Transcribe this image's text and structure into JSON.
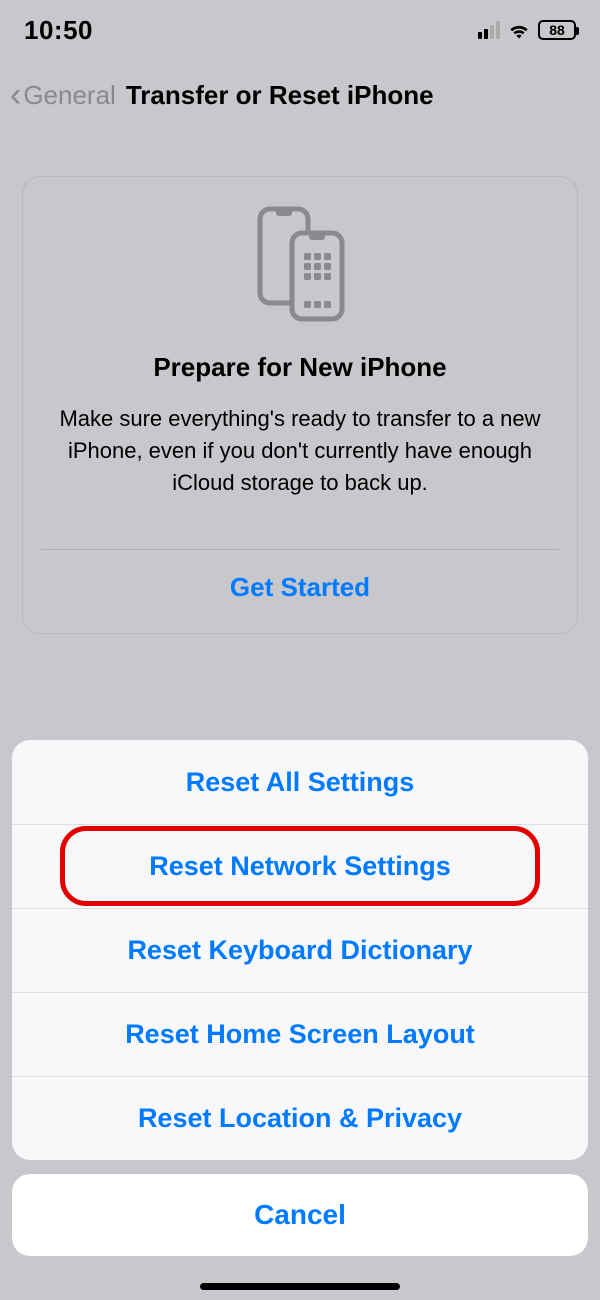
{
  "status": {
    "time": "10:50",
    "battery_pct": "88"
  },
  "nav": {
    "back_label": "General",
    "title": "Transfer or Reset iPhone"
  },
  "card": {
    "title": "Prepare for New iPhone",
    "body": "Make sure everything's ready to transfer to a new iPhone, even if you don't currently have enough iCloud storage to back up.",
    "cta": "Get Started"
  },
  "sheet": {
    "options": [
      "Reset All Settings",
      "Reset Network Settings",
      "Reset Keyboard Dictionary",
      "Reset Home Screen Layout",
      "Reset Location & Privacy"
    ],
    "highlight_index": 1,
    "cancel": "Cancel"
  },
  "colors": {
    "link": "#007aff",
    "highlight": "#e30000"
  }
}
